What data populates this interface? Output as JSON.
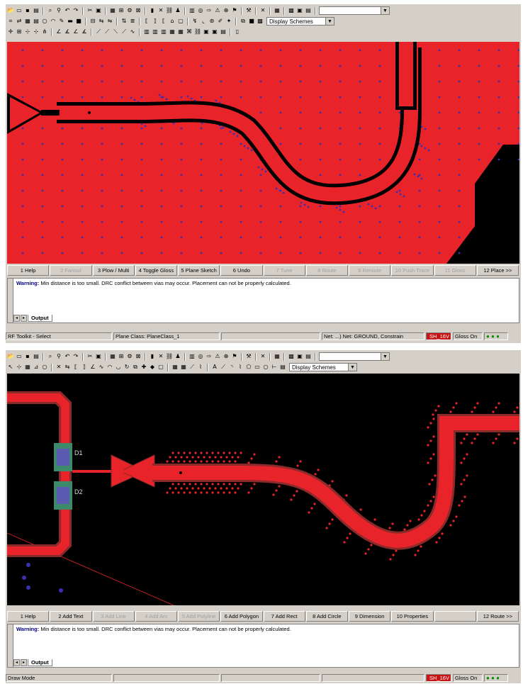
{
  "toolbar": {
    "display_schemes": "Display Schemes",
    "combo_arrow": "▼"
  },
  "window1": {
    "fkeys": [
      {
        "label": "1 Help",
        "enabled": true
      },
      {
        "label": "2 Fanout",
        "enabled": false
      },
      {
        "label": "3 Plow / Multi",
        "enabled": true
      },
      {
        "label": "4 Toggle Gloss",
        "enabled": true
      },
      {
        "label": "5 Plane Sketch",
        "enabled": true
      },
      {
        "label": "6 Undo",
        "enabled": true
      },
      {
        "label": "7 Tune",
        "enabled": false
      },
      {
        "label": "8 Route",
        "enabled": false
      },
      {
        "label": "9 Reroute",
        "enabled": false
      },
      {
        "label": "10 Push Trace",
        "enabled": false
      },
      {
        "label": "11 Gloss",
        "enabled": false
      },
      {
        "label": "12 Place >>",
        "enabled": true
      }
    ],
    "output_warning_label": "Warning:",
    "output_warning_text": "Min distance is too small. DRC conflict between vias may occur. Placement can not be properly calculated.",
    "output_tab": "Output",
    "status": {
      "mode": "RF Toolkit - Select",
      "plane_class": "Plane Class: PlaneClass_1",
      "net": "Net: ...) Net: GROUND, Constrain",
      "layer": "SH_16V",
      "gloss": "Gloss On",
      "lights": "● ● ●"
    },
    "colors": {
      "plane": "#e8232a",
      "background": "#000000",
      "vias": "#3a2fb0"
    }
  },
  "window2": {
    "fkeys": [
      {
        "label": "1 Help",
        "enabled": true
      },
      {
        "label": "2 Add Text",
        "enabled": true
      },
      {
        "label": "3 Add Line",
        "enabled": false
      },
      {
        "label": "4 Add Arc",
        "enabled": false
      },
      {
        "label": "5 Add Polyline",
        "enabled": false
      },
      {
        "label": "6 Add Polygon",
        "enabled": true
      },
      {
        "label": "7 Add Rect",
        "enabled": true
      },
      {
        "label": "8 Add Circle",
        "enabled": true
      },
      {
        "label": "9 Dimension",
        "enabled": true
      },
      {
        "label": "10 Properties",
        "enabled": true
      },
      {
        "label": "",
        "enabled": true
      },
      {
        "label": "12 Route >>",
        "enabled": true
      }
    ],
    "output_warning_label": "Warning:",
    "output_warning_text": "Min distance is too small. DRC conflict between vias may occur. Placement can not be properly calculated.",
    "output_tab": "Output",
    "status": {
      "mode": "Draw Mode",
      "layer": "SH_16V",
      "gloss": "Gloss On",
      "lights": "● ● ●"
    },
    "refdes": {
      "d1": "D1",
      "d2": "D2"
    },
    "colors": {
      "trace": "#e8232a",
      "background": "#000000",
      "vias": "#e8232a",
      "pad": "#5a5ab0"
    }
  }
}
